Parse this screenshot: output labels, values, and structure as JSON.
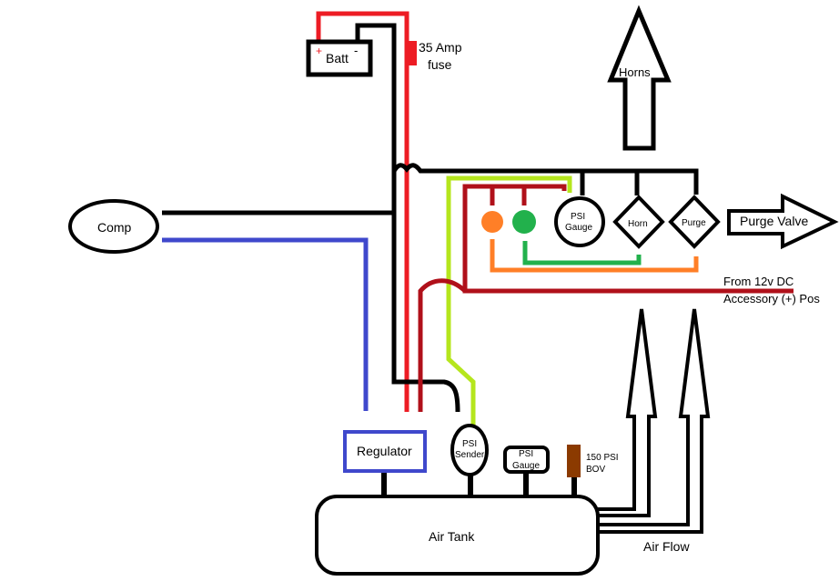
{
  "labels": {
    "battery": "Batt",
    "battery_plus": "+",
    "battery_minus": "-",
    "fuse_line1": "35 Amp",
    "fuse_line2": "fuse",
    "horns": "Horns",
    "compressor": "Comp",
    "psi_gauge_top_1": "PSI",
    "psi_gauge_top_2": "Gauge",
    "horn_switch": "Horn",
    "purge_switch": "Purge",
    "purge_valve": "Purge Valve",
    "power_line1": "From 12v DC",
    "power_line2": "Accessory (+) Pos",
    "regulator": "Regulator",
    "psi_sender_1": "PSI",
    "psi_sender_2": "Sender",
    "psi_gauge_tank_1": "PSI",
    "psi_gauge_tank_2": "Gauge",
    "bov_1": "150 PSI",
    "bov_2": "BOV",
    "air_tank": "Air Tank",
    "air_flow": "Air Flow"
  },
  "colors": {
    "power_red": "#ed1c24",
    "ground_black": "#000000",
    "compressor_blue": "#3f48cc",
    "sensor_lime": "#b5e61d",
    "accessory_darkred": "#b0101a",
    "indicator_orange": "#ff7f27",
    "indicator_green": "#22b14c",
    "bov_brown": "#8b3a00"
  }
}
